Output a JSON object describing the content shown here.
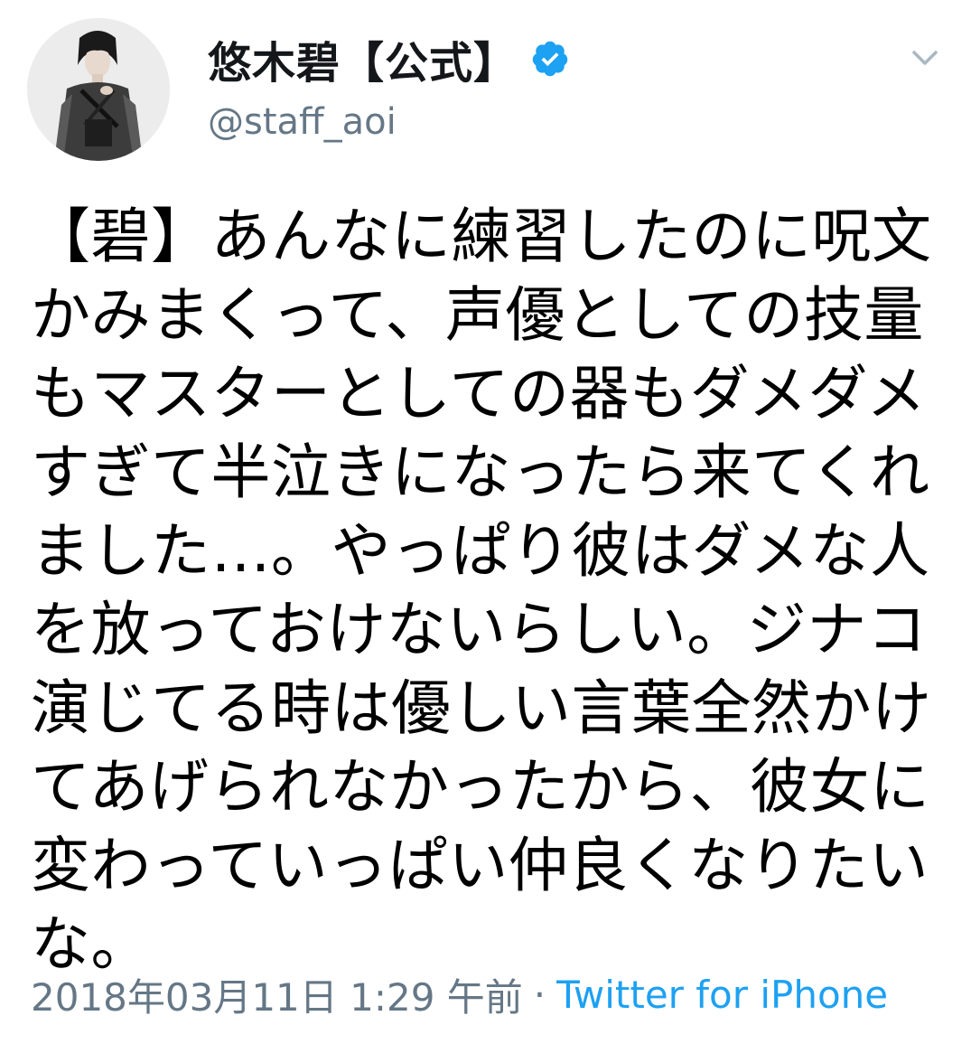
{
  "user": {
    "display_name": "悠木碧【公式】",
    "handle": "@staff_aoi",
    "verified": true
  },
  "tweet": {
    "lines": [
      "【碧】あんなに練習したのに呪文",
      "かみまくって、声優としての技量",
      "もマスターとしての器もダメダメ",
      "すぎて半泣きになったら来てくれ",
      "ました…。やっぱり彼はダメな人",
      "を放っておけないらしい。ジナコ",
      "演じてる時は優しい言葉全然かけ",
      "てあげられなかったから、彼女に",
      "変わっていっぱい仲良くなりたい",
      "な。"
    ]
  },
  "meta": {
    "timestamp": "2018年03月11日 1:29 午前",
    "separator": "·",
    "source": "Twitter for iPhone"
  },
  "icons": {
    "verified": "verified-badge-icon",
    "menu": "chevron-down-icon"
  },
  "colors": {
    "verified_blue": "#1da1f2",
    "secondary_text": "#657786",
    "link": "#1da1f2"
  }
}
